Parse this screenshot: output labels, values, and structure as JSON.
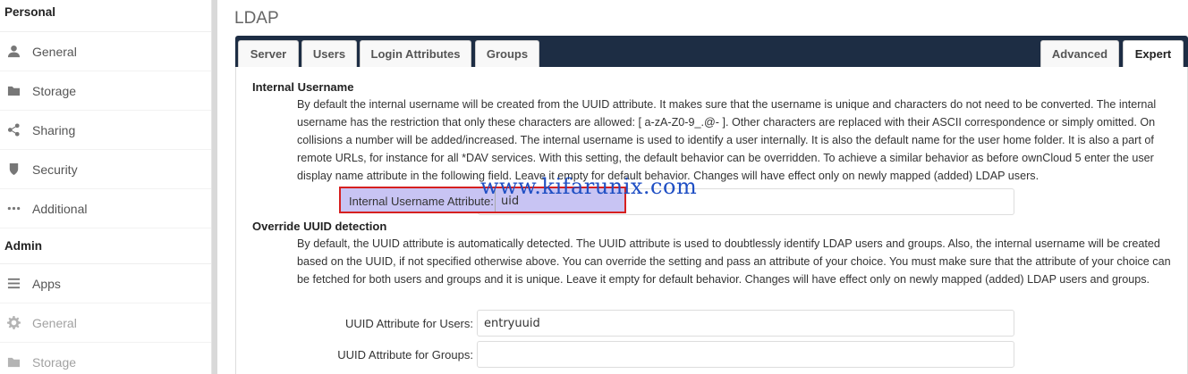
{
  "sidebar": {
    "personal_title": "Personal",
    "personal_items": [
      {
        "label": "General",
        "icon": "user-icon"
      },
      {
        "label": "Storage",
        "icon": "folder-icon"
      },
      {
        "label": "Sharing",
        "icon": "share-icon"
      },
      {
        "label": "Security",
        "icon": "shield-icon"
      },
      {
        "label": "Additional",
        "icon": "more-icon"
      }
    ],
    "admin_title": "Admin",
    "admin_items": [
      {
        "label": "Apps",
        "icon": "menu-icon"
      },
      {
        "label": "General",
        "icon": "gear-icon"
      },
      {
        "label": "Storage",
        "icon": "folder-icon"
      }
    ]
  },
  "page": {
    "title": "LDAP"
  },
  "tabs": {
    "left": [
      "Server",
      "Users",
      "Login Attributes",
      "Groups"
    ],
    "right": [
      "Advanced",
      "Expert"
    ],
    "active": "Expert"
  },
  "internal_username": {
    "heading": "Internal Username",
    "description": "By default the internal username will be created from the UUID attribute. It makes sure that the username is unique and characters do not need to be converted. The internal username has the restriction that only these characters are allowed: [ a-zA-Z0-9_.@- ]. Other characters are replaced with their ASCII correspondence or simply omitted. On collisions a number will be added/increased. The internal username is used to identify a user internally. It is also the default name for the user home folder. It is also a part of remote URLs, for instance for all *DAV services. With this setting, the default behavior can be overridden. To achieve a similar behavior as before ownCloud 5 enter the user display name attribute in the following field. Leave it empty for default behavior. Changes will have effect only on newly mapped (added) LDAP users.",
    "attribute_label": "Internal Username Attribute:",
    "attribute_value": "uid"
  },
  "override_uuid": {
    "heading": "Override UUID detection",
    "description": "By default, the UUID attribute is automatically detected. The UUID attribute is used to doubtlessly identify LDAP users and groups. Also, the internal username will be created based on the UUID, if not specified otherwise above. You can override the setting and pass an attribute of your choice. You must make sure that the attribute of your choice can be fetched for both users and groups and it is unique. Leave it empty for default behavior. Changes will have effect only on newly mapped (added) LDAP users and groups.",
    "users_label": "UUID Attribute for Users:",
    "users_value": "entryuuid",
    "groups_label": "UUID Attribute for Groups:",
    "groups_value": ""
  },
  "watermark": "www.kifarunix.com",
  "colors": {
    "tabbar": "#1d2d44",
    "highlight_fill": "#c8c4f3",
    "highlight_border": "#d62020",
    "watermark": "#1f4fc4"
  }
}
